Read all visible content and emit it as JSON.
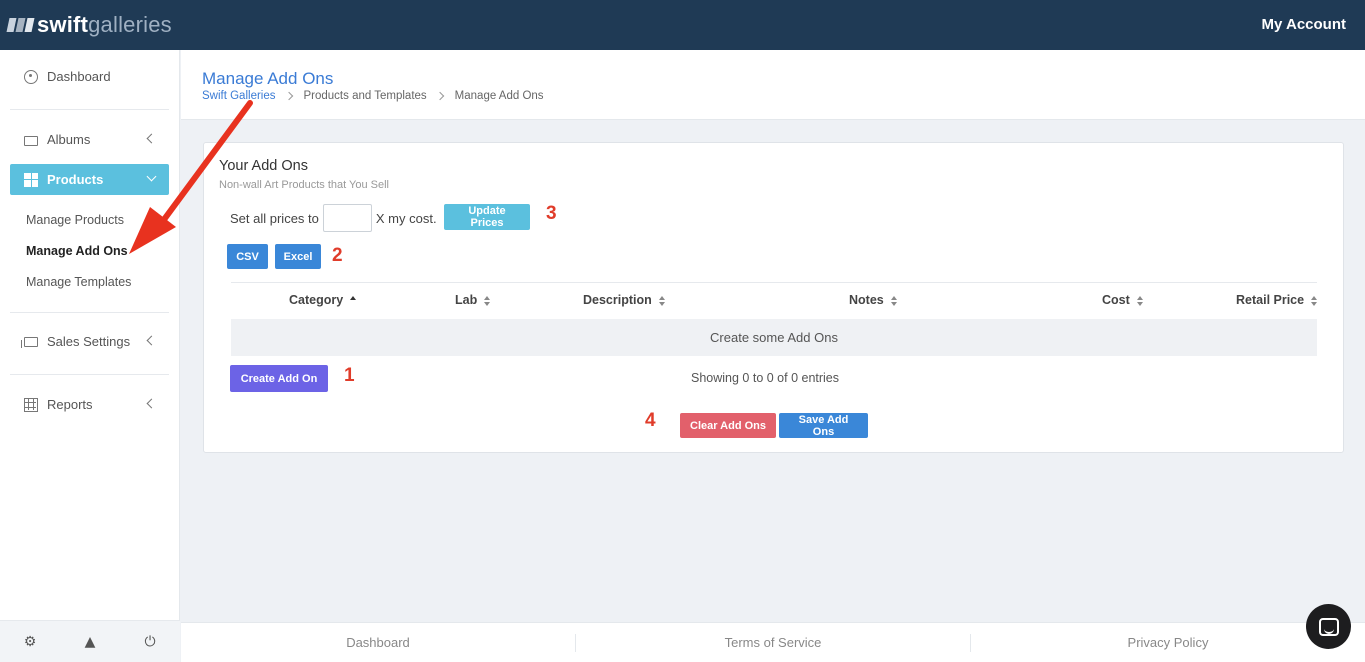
{
  "app": {
    "logo_bold": "swift",
    "logo_light": "galleries",
    "account_label": "My Account"
  },
  "sidebar": {
    "dashboard": "Dashboard",
    "albums": "Albums",
    "products": "Products",
    "sub_items": [
      "Manage Products",
      "Manage Add Ons",
      "Manage Templates"
    ],
    "sales_settings": "Sales Settings",
    "reports": "Reports",
    "bottom_icons": [
      "gear-icon",
      "graduation-cap-icon",
      "power-icon"
    ],
    "accent_color": "#5bc0de"
  },
  "header": {
    "title": "Manage Add Ons",
    "breadcrumb": [
      "Swift Galleries",
      "Products and Templates",
      "Manage Add Ons"
    ]
  },
  "card": {
    "title": "Your Add Ons",
    "subtitle": "Non-wall Art Products that You Sell",
    "price_prefix": "Set all prices to",
    "price_value": "",
    "price_suffix": "X my cost.",
    "update_button": "Update Prices",
    "csv_button": "CSV",
    "excel_button": "Excel",
    "table": {
      "columns": [
        "Category",
        "Lab",
        "Description",
        "Notes",
        "Cost",
        "Retail Price"
      ],
      "empty_text": "Create some Add Ons"
    },
    "create_button": "Create Add On",
    "showing_text": "Showing 0 to 0 of 0 entries",
    "clear_button": "Clear Add Ons",
    "save_button": "Save Add Ons"
  },
  "annotations": {
    "numbers": [
      "1",
      "2",
      "3",
      "4"
    ],
    "color": "#e03c2a"
  },
  "footer": {
    "links": [
      "Dashboard",
      "Terms of Service",
      "Privacy Policy"
    ]
  }
}
